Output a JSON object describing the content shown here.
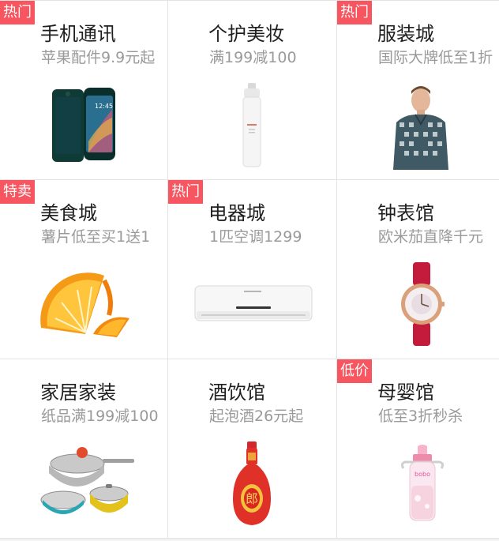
{
  "categories": [
    {
      "title": "手机通讯",
      "subtitle": "苹果配件9.9元起",
      "tag": "热门",
      "icon": "smartphone-icon"
    },
    {
      "title": "个护美妆",
      "subtitle": "满199减100",
      "tag": "",
      "icon": "spray-bottle-icon"
    },
    {
      "title": "服装城",
      "subtitle": "国际大牌低至1折",
      "tag": "热门",
      "icon": "shirt-model-icon"
    },
    {
      "title": "美食城",
      "subtitle": "薯片低至买1送1",
      "tag": "特卖",
      "icon": "orange-slices-icon"
    },
    {
      "title": "电器城",
      "subtitle": "1匹空调1299",
      "tag": "热门",
      "icon": "air-conditioner-icon"
    },
    {
      "title": "钟表馆",
      "subtitle": "欧米茄直降千元",
      "tag": "",
      "icon": "wristwatch-icon"
    },
    {
      "title": "家居家装",
      "subtitle": "纸品满199减100",
      "tag": "",
      "icon": "cookware-icon"
    },
    {
      "title": "酒饮馆",
      "subtitle": "起泡酒26元起",
      "tag": "",
      "icon": "liquor-bottle-icon"
    },
    {
      "title": "母婴馆",
      "subtitle": "低至3折秒杀",
      "tag": "低价",
      "icon": "baby-bottle-icon"
    }
  ],
  "product_marks": {
    "liquor_label": "郎",
    "baby_bottle_brand": "bobo"
  },
  "colors": {
    "tag_bg": "#f7555f",
    "title_text": "#1f1f1f",
    "subtitle_text": "#9a9a9a",
    "divider": "#e3e3e3"
  }
}
